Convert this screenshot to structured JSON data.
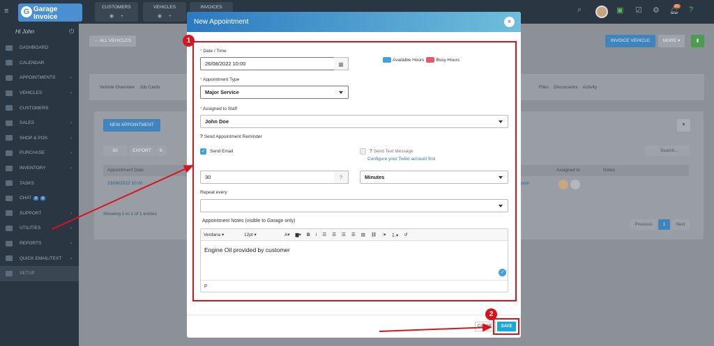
{
  "topbar": {
    "logo_line1": "Garage",
    "logo_line2": "Invoice",
    "tabs": [
      {
        "label": "CUSTOMERS"
      },
      {
        "label": "VEHICLES"
      },
      {
        "label": "INVOICES"
      }
    ],
    "notification_count": "21"
  },
  "sidebar": {
    "greeting": "Hi John",
    "items": [
      {
        "label": "DASHBOARD"
      },
      {
        "label": "CALENDAR"
      },
      {
        "label": "APPOINTMENTS"
      },
      {
        "label": "VEHICLES"
      },
      {
        "label": "CUSTOMERS"
      },
      {
        "label": "SALES"
      },
      {
        "label": "SHOP & POS"
      },
      {
        "label": "PURCHASE"
      },
      {
        "label": "INVENTORY"
      },
      {
        "label": "TASKS"
      },
      {
        "label": "CHAT"
      },
      {
        "label": "SUPPORT"
      },
      {
        "label": "UTILITIES"
      },
      {
        "label": "REPORTS"
      },
      {
        "label": "QUICK EMAIL/TEXT"
      },
      {
        "label": "SETUP"
      }
    ],
    "chat_badges": [
      "0",
      "0"
    ]
  },
  "background": {
    "all_vehicles": "← ALL VEHICLES",
    "invoice_vehicle": "INVOICE VEHICLE",
    "more": "MORE ▾",
    "subtabs": [
      "Vehicle Overview",
      "Job Cards"
    ],
    "subtabs_right": [
      "Files",
      "Discussions",
      "Activity"
    ],
    "new_appointment": "NEW APPOINTMENT",
    "page_size": "50",
    "export": "EXPORT",
    "search_placeholder": "Search...",
    "col_appointment_date": "Appointment Date",
    "col_assigned_to": "Assigned to",
    "col_notes": "Notes",
    "row_date": "23/08/2022 10:00",
    "row_email_fragment": ".com",
    "showing": "Showing 1 to 1 of 1 entries",
    "pager": [
      "Previous",
      "1",
      "Next"
    ]
  },
  "modal": {
    "title": "New Appointment",
    "date_label": "Date / Time",
    "date_value": "26/08/2022 10:00",
    "legend_available": "Available Hours",
    "legend_busy": "Busy Hours",
    "type_label": "Appointment Type",
    "type_value": "Major Service",
    "staff_label": "Assigned to Staff",
    "staff_value": "John Doe",
    "reminder_label": "Send Appointment Reminder",
    "send_email": "Send Email",
    "send_email_checked": true,
    "send_text": "Send Text Message",
    "send_text_checked": false,
    "twilio_link": "Configure your Twilio account first",
    "reminder_amount": "30",
    "reminder_unit": "Minutes",
    "repeat_label": "Repeat every",
    "repeat_value": "",
    "notes_label": "Appointment Notes (visible to Garage only)",
    "editor_font": "Verdana",
    "editor_size": "12pt",
    "notes_value": "Engine Oil provided by customer",
    "editor_status": "p",
    "close_button": "CLOSE",
    "save_button": "SAVE"
  },
  "annotations": {
    "step1": "1",
    "step2": "2"
  },
  "colors": {
    "available": "#3fa1e0",
    "busy": "#e8596b",
    "annotation_red": "#d7141e",
    "header_start": "#2a7ac0",
    "header_end": "#6fbedc"
  }
}
